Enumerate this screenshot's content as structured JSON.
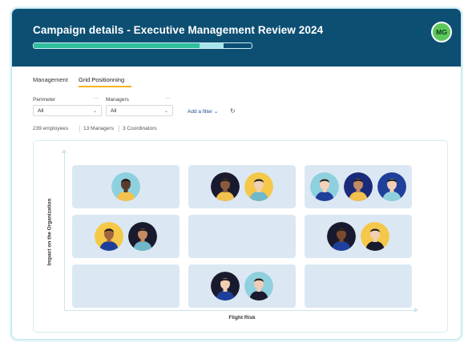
{
  "header": {
    "title": "Campaign details - Executive Management Review 2024",
    "user_initials": "MG",
    "progress": {
      "completed_fraction": 0.76,
      "partial_fraction": 0.11
    }
  },
  "tabs": [
    {
      "label": "Management",
      "active": false
    },
    {
      "label": "Grid Positionning",
      "active": true
    }
  ],
  "filters": {
    "perimeter": {
      "label": "Perimeter",
      "value": "All"
    },
    "managers": {
      "label": "Managers",
      "value": "All"
    },
    "add_filter_label": "Add a filter"
  },
  "stats": [
    "239 employees",
    "13 Managers",
    "3 Coordinators"
  ],
  "grid": {
    "y_axis_label": "Impact on the Organization",
    "x_axis_label": "Flight Risk",
    "cells": [
      {
        "row": 1,
        "col": 1,
        "people": [
          {
            "bg": "#8fd0df",
            "skin": "#5b3a2a",
            "shirt": "#f2c14e"
          }
        ]
      },
      {
        "row": 1,
        "col": 2,
        "people": [
          {
            "bg": "#1a1a2e",
            "skin": "#8a5a3c",
            "shirt": "#f2c14e"
          },
          {
            "bg": "#f5c84a",
            "skin": "#f1cfb1",
            "shirt": "#6fb7c9"
          }
        ]
      },
      {
        "row": 1,
        "col": 3,
        "people": [
          {
            "bg": "#8fd0df",
            "skin": "#f3d2b8",
            "shirt": "#1e3f9a"
          },
          {
            "bg": "#1a2a7a",
            "skin": "#c08a63",
            "shirt": "#f2c14e"
          },
          {
            "bg": "#1e3f9a",
            "skin": "#f0cdb4",
            "shirt": "#8fd0df"
          }
        ]
      },
      {
        "row": 2,
        "col": 1,
        "people": [
          {
            "bg": "#f5c84a",
            "skin": "#a0653f",
            "shirt": "#1e3f9a"
          },
          {
            "bg": "#1a1a2e",
            "skin": "#c48b62",
            "shirt": "#6fb7c9"
          }
        ]
      },
      {
        "row": 2,
        "col": 2,
        "people": []
      },
      {
        "row": 2,
        "col": 3,
        "people": [
          {
            "bg": "#1a1a2e",
            "skin": "#7a4a2f",
            "shirt": "#1e3f9a"
          },
          {
            "bg": "#f5c84a",
            "skin": "#f1cfb1",
            "shirt": "#1a1a2e"
          }
        ]
      },
      {
        "row": 3,
        "col": 1,
        "people": []
      },
      {
        "row": 3,
        "col": 2,
        "people": [
          {
            "bg": "#1a1a2e",
            "skin": "#f1cfb1",
            "shirt": "#1e3f9a"
          },
          {
            "bg": "#8fd0df",
            "skin": "#f0cdb4",
            "shirt": "#1a1a2e"
          }
        ]
      },
      {
        "row": 3,
        "col": 3,
        "people": []
      }
    ]
  }
}
